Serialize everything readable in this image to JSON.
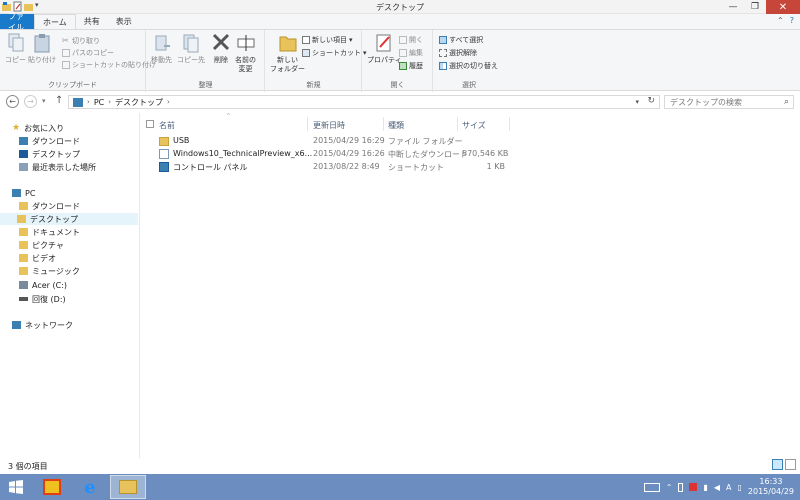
{
  "window": {
    "title": "デスクトップ",
    "controls": {
      "minimize": "—",
      "maximize": "❐",
      "close": "✕"
    }
  },
  "ribbon_tabs": [
    "ファイル",
    "ホーム",
    "共有",
    "表示"
  ],
  "ribbon": {
    "clipboard": {
      "copy": "コピー",
      "paste": "貼り付け",
      "cut": "切り取り",
      "copy_path": "パスのコピー",
      "paste_shortcut": "ショートカットの貼り付け",
      "group_label": "クリップボード"
    },
    "organize": {
      "move_to": "移動先",
      "copy_to": "コピー先",
      "delete": "削除",
      "rename_line1": "名前の",
      "rename_line2": "変更",
      "group_label": "整理"
    },
    "new": {
      "new_folder_line1": "新しい",
      "new_folder_line2": "フォルダー",
      "new_item": "新しい項目",
      "shortcut": "ショートカット",
      "group_label": "新規"
    },
    "open": {
      "properties": "プロパティ",
      "open": "開く",
      "edit": "編集",
      "history": "履歴",
      "group_label": "開く"
    },
    "select": {
      "select_all": "すべて選択",
      "select_none": "選択解除",
      "invert": "選択の切り替え",
      "group_label": "選択"
    }
  },
  "address": {
    "crumbs": [
      "PC",
      "デスクトップ"
    ],
    "search_placeholder": "デスクトップの検索"
  },
  "nav": {
    "favorites": "お気に入り",
    "fav_items": [
      "ダウンロード",
      "デスクトップ",
      "最近表示した場所"
    ],
    "pc": "PC",
    "pc_items": [
      "ダウンロード",
      "デスクトップ",
      "ドキュメント",
      "ピクチャ",
      "ビデオ",
      "ミュージック",
      "Acer (C:)",
      "回復 (D:)"
    ],
    "network": "ネットワーク"
  },
  "columns": {
    "name": "名前",
    "date": "更新日時",
    "type": "種類",
    "size": "サイズ"
  },
  "files": [
    {
      "name": "USB",
      "date": "2015/04/29 16:29",
      "type": "ファイル フォルダー",
      "size": "",
      "icon": "folder-icon"
    },
    {
      "name": "Windows10_TechnicalPreview_x6...",
      "date": "2015/04/29 16:26",
      "type": "中断したダウンロード",
      "size": "570,546 KB",
      "icon": "partial-download-icon"
    },
    {
      "name": "コントロール パネル",
      "date": "2013/08/22 8:49",
      "type": "ショートカット",
      "size": "1 KB",
      "icon": "shortcut-icon"
    }
  ],
  "status": {
    "item_count": "3 個の項目"
  },
  "taskbar": {
    "time": "16:33",
    "date": "2015/04/29",
    "ime": "A"
  },
  "colors": {
    "file_tab": "#1979ca",
    "taskbar": "#6b8dbf",
    "close_button": "#c7463a",
    "selection": "#e5f3fb",
    "folder": "#e8c25a"
  }
}
